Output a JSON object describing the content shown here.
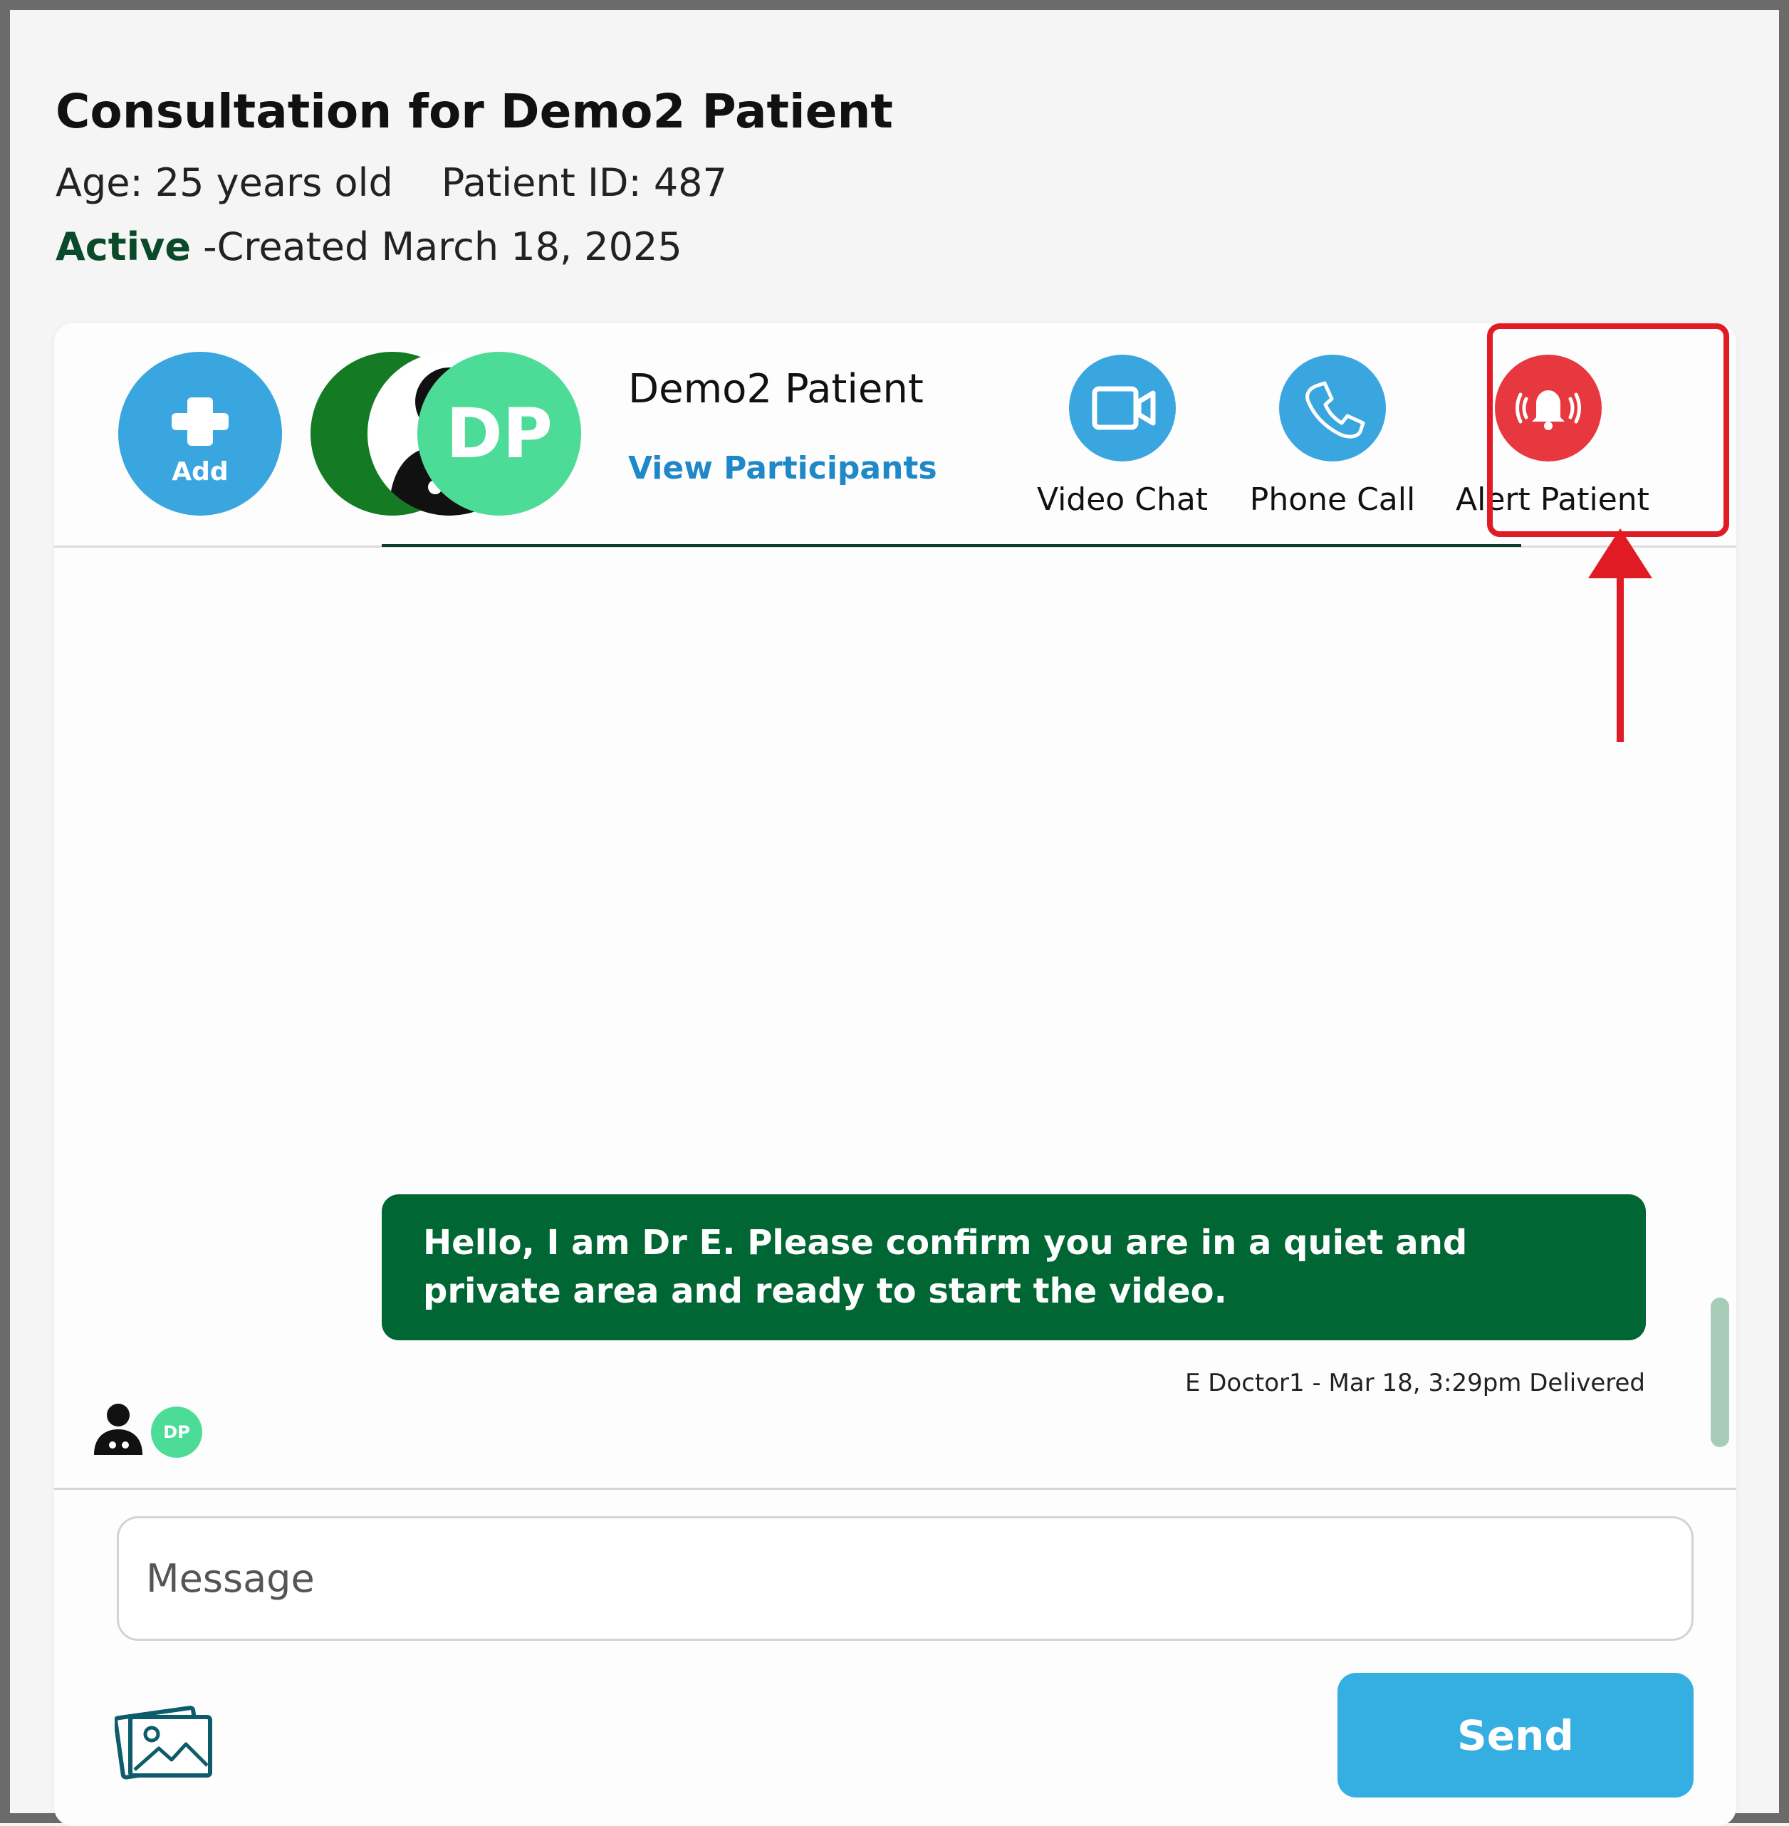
{
  "header": {
    "title": "Consultation for Demo2 Patient",
    "age": "Age: 25 years old",
    "patient_id": "Patient ID: 487",
    "status_label": "Active",
    "created": " -Created March 18, 2025"
  },
  "topbar": {
    "add_label": "Add",
    "avatar_initials": "DP",
    "participant_name": "Demo2 Patient",
    "view_participants": "View Participants",
    "actions": [
      {
        "label": "Video Chat",
        "icon": "video-icon"
      },
      {
        "label": "Phone Call",
        "icon": "phone-icon"
      },
      {
        "label": "Alert Patient",
        "icon": "alarm-bell-icon"
      }
    ]
  },
  "messages": [
    {
      "text": "Hello, I am Dr E.  Please confirm you are in a quiet and private area and ready to start the video.",
      "meta": "E Doctor1 - Mar 18, 3:29pm Delivered"
    }
  ],
  "read_receipts": {
    "initials": "DP"
  },
  "composer": {
    "placeholder": "Message",
    "value": "",
    "send_label": "Send"
  },
  "colors": {
    "brand_blue": "#3aa6e0",
    "alert_red": "#e8383f",
    "bubble_green": "#006633",
    "avatar_mint": "#4ddc97",
    "annotation_red": "#e01b24"
  }
}
